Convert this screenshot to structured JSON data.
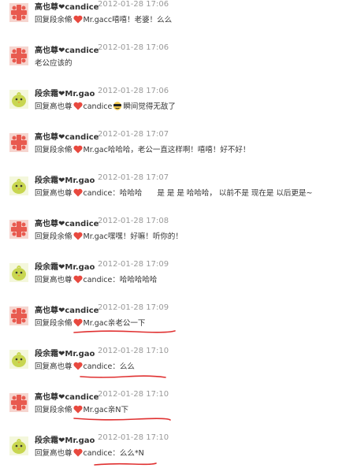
{
  "colors": {
    "name_text": "#333333",
    "time_text": "#999999",
    "heart": "#e8493f",
    "avatar_cross": "#e85a4f",
    "avatar_chick": "#c8d650",
    "annotation_ink": "#e03030"
  },
  "comments": [
    {
      "author": "高也尊❤candice",
      "time": "2012-01-28 17:06",
      "avatar": "cross-avatar",
      "reply_prefix": "回复段余翛",
      "reply_target": "Mr.gac",
      "reply_text": "c嘻嘻！老婆！么么"
    },
    {
      "author": "高也尊❤candice",
      "time": "2012-01-28 17:06",
      "avatar": "cross-avatar",
      "reply_prefix": "老公应该的",
      "reply_target": "",
      "reply_text": ""
    },
    {
      "author": "段余霜❤Mr.gao",
      "time": "2012-01-28 17:06",
      "avatar": "chick-avatar",
      "reply_prefix": "回复高也尊",
      "reply_target": "candice",
      "reply_text": "瞬间觉得无敌了"
    },
    {
      "author": "高也尊❤candice",
      "time": "2012-01-28 17:07",
      "avatar": "cross-avatar",
      "reply_prefix": "回复段余翛",
      "reply_target": "Mr.gac",
      "reply_text": "哈哈哈，老公一直这样啊！嘻嘻！好不好！"
    },
    {
      "author": "段余霜❤Mr.gao",
      "time": "2012-01-28 17:07",
      "avatar": "chick-avatar",
      "reply_prefix": "回复高也尊",
      "reply_target": "candice",
      "reply_text": "：哈哈哈　　是 是 是  哈哈哈，  以前不是  现在是  以后更是~"
    },
    {
      "author": "高也尊❤candice",
      "time": "2012-01-28 17:08",
      "avatar": "cross-avatar",
      "reply_prefix": "回复段余翛",
      "reply_target": "Mr.gac",
      "reply_text": "嘿嘿！好嘛！听你的！"
    },
    {
      "author": "段余霜❤Mr.gao",
      "time": "2012-01-28 17:09",
      "avatar": "chick-avatar",
      "reply_prefix": "回复高也尊",
      "reply_target": "candice",
      "reply_text": "：哈哈哈哈哈"
    },
    {
      "author": "高也尊❤candice",
      "time": "2012-01-28 17:09",
      "avatar": "cross-avatar",
      "reply_prefix": "回复段余翛",
      "reply_target": "Mr.gac",
      "reply_text": "亲老公一下"
    },
    {
      "author": "段余霜❤Mr.gao",
      "time": "2012-01-28 17:10",
      "avatar": "chick-avatar",
      "reply_prefix": "回复高也尊",
      "reply_target": "candice",
      "reply_text": "：么么"
    },
    {
      "author": "高也尊❤candice",
      "time": "2012-01-28 17:10",
      "avatar": "cross-avatar",
      "reply_prefix": "回复段余翛",
      "reply_target": "Mr.gac",
      "reply_text": "亲N下"
    },
    {
      "author": "段余霜❤Mr.gao",
      "time": "2012-01-28 17:10",
      "avatar": "chick-avatar",
      "reply_prefix": "回复高也尊",
      "reply_target": "candice",
      "reply_text": "：么么*N"
    }
  ]
}
